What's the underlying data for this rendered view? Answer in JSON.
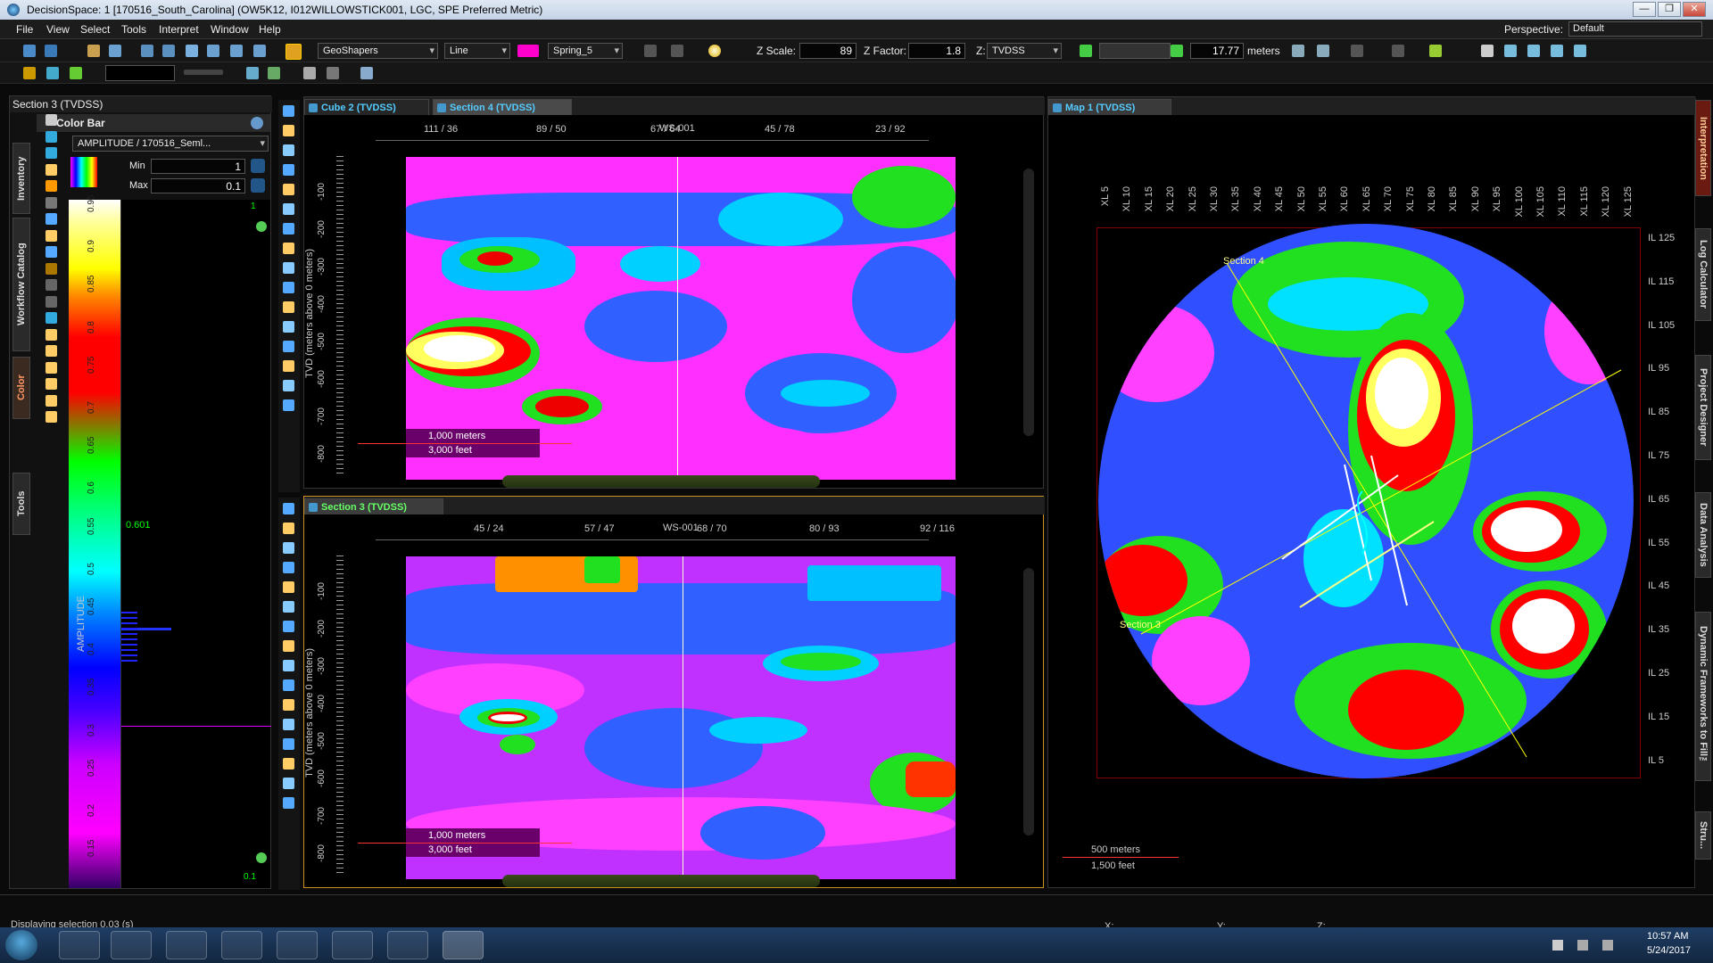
{
  "window": {
    "title": "DecisionSpace: 1 [170516_South_Carolina] (OW5K12, I012WILLOWSTICK001, LGC, SPE Preferred Metric)",
    "minimize": "—",
    "maximize": "❐",
    "close": "✕"
  },
  "menu": {
    "items": [
      "File",
      "View",
      "Select",
      "Tools",
      "Interpret",
      "Window",
      "Help"
    ],
    "perspective_label": "Perspective:",
    "perspective_value": "Default"
  },
  "toolbar": {
    "geoshapers": "GeoShapers",
    "line_mode": "Line",
    "color_scheme": "Spring_5",
    "zscale_label": "Z Scale:",
    "zscale_value": "89",
    "zfactor_label": "Z Factor:",
    "zfactor_value": "1.8",
    "z_label": "Z:",
    "z_domain": "TVDSS",
    "depth_value": "17.77",
    "depth_unit": "meters"
  },
  "left_panel": {
    "header": "Section 3 (TVDSS)",
    "colorbar_title": "Color Bar",
    "attribute": "AMPLITUDE / 170516_Seml...",
    "min_label": "Min",
    "min_value": "1",
    "max_label": "Max",
    "max_value": "0.1",
    "axis_title": "AMPLITUDE",
    "ticks": [
      "0.95",
      "0.9",
      "0.85",
      "0.8",
      "0.75",
      "0.7",
      "0.65",
      "0.6",
      "0.55",
      "0.5",
      "0.45",
      "0.4",
      "0.35",
      "0.3",
      "0.25",
      "0.2",
      "0.15"
    ],
    "marker_value": "0.601",
    "top_marker": "1",
    "bottom_marker": "0.1",
    "side_tabs": [
      "Inventory",
      "Workflow Catalog",
      "Color",
      "Tools"
    ]
  },
  "cube_view": {
    "tab_inactive": "Cube 2 (TVDSS)",
    "tab_active": "Section 4 (TVDSS)",
    "well": "WS-001",
    "top_ticks": [
      "111 / 36",
      "89 / 50",
      "67 / 64",
      "45 / 78",
      "23 / 92"
    ],
    "z_title": "TVD (meters above 0 meters)",
    "z_ticks": [
      "-100",
      "-200",
      "-300",
      "-400",
      "-500",
      "-600",
      "-700",
      "-800"
    ],
    "scale_m": "1,000 meters",
    "scale_ft": "3,000 feet"
  },
  "section3_view": {
    "tab": "Section 3 (TVDSS)",
    "well": "WS-001",
    "top_ticks": [
      "45 / 24",
      "57 / 47",
      "68 / 70",
      "80 / 93",
      "92 / 116"
    ],
    "z_title": "TVD (meters above 0 meters)",
    "z_ticks": [
      "-100",
      "-200",
      "-300",
      "-400",
      "-500",
      "-600",
      "-700",
      "-800"
    ],
    "scale_m": "1,000 meters",
    "scale_ft": "3,000 feet"
  },
  "map_view": {
    "tab": "Map 1 (TVDSS)",
    "xl_ticks": [
      "XL 5",
      "XL 10",
      "XL 15",
      "XL 20",
      "XL 25",
      "XL 30",
      "XL 35",
      "XL 40",
      "XL 45",
      "XL 50",
      "XL 55",
      "XL 60",
      "XL 65",
      "XL 70",
      "XL 75",
      "XL 80",
      "XL 85",
      "XL 90",
      "XL 95",
      "XL 100",
      "XL 105",
      "XL 110",
      "XL 115",
      "XL 120",
      "XL 125"
    ],
    "il_ticks": [
      "IL 125",
      "IL 115",
      "IL 105",
      "IL 95",
      "IL 85",
      "IL 75",
      "IL 65",
      "IL 55",
      "IL 45",
      "IL 35",
      "IL 25",
      "IL 15",
      "IL 5"
    ],
    "section4_label": "Section 4",
    "section3_label": "Section 3",
    "scale_m": "500 meters",
    "scale_ft": "1,500 feet"
  },
  "right_tabs": [
    "Interpretation",
    "Log Calculator",
    "Project Designer",
    "Data Analysis",
    "Dynamic Frameworks to Fill™",
    "Stru..."
  ],
  "status": {
    "text": "Displaying selection 0.03 (s)",
    "x_label": "X:",
    "y_label": "Y:",
    "z_label": "Z:"
  },
  "taskbar": {
    "time": "10:57 AM",
    "date": "5/24/2017"
  }
}
